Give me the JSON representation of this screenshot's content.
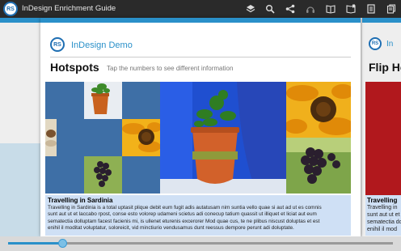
{
  "app": {
    "logo": "RS",
    "title": "InDesign Enrichment Guide"
  },
  "toolbar": {
    "icons": [
      "layers-icon",
      "search-icon",
      "share-icon",
      "headphones-icon",
      "book-icon",
      "bookmark-add-icon",
      "document-icon",
      "copy-icon"
    ]
  },
  "page": {
    "brand": "InDesign Demo",
    "logo": "RS",
    "title": "Hotspots",
    "subtitle": "Tap the numbers to see different information",
    "caption_title": "Travelling in Sardinia",
    "caption_lines": [
      "Travelling in Sardinia is a total uptasit plique debit eum fugit adis autatusam nim suntia vello quae si aut ad ut es comnis",
      "sunt aut ut et laccabo rpost, conse esto volorep udameni scietus adi conecup tatium quassit ut illiquet et liciat aut eum",
      "sematectia dolluptam facest facienis mi, is ullenet eturenis excerorer Mod quae cus, te ne plibus niscust doluptas et est",
      "enihil il moditat voluptatur, soloreicit, vid minctiurio vendusamus dunt reessus dempore perunt adi doluptate."
    ]
  },
  "next_page": {
    "brand": "In",
    "title": "Flip He",
    "caption_title": "Travelling",
    "caption_lines": [
      "Travelling in",
      "sunt aut ut et",
      "sematectia do",
      "enihil il mod"
    ]
  },
  "colors": {
    "accent": "#2a90c9",
    "caption_bg": "#cfe0f5",
    "topbar": "#2a2a2a",
    "flip_red": "#b1181d"
  },
  "scroll": {
    "progress": 0.14
  }
}
